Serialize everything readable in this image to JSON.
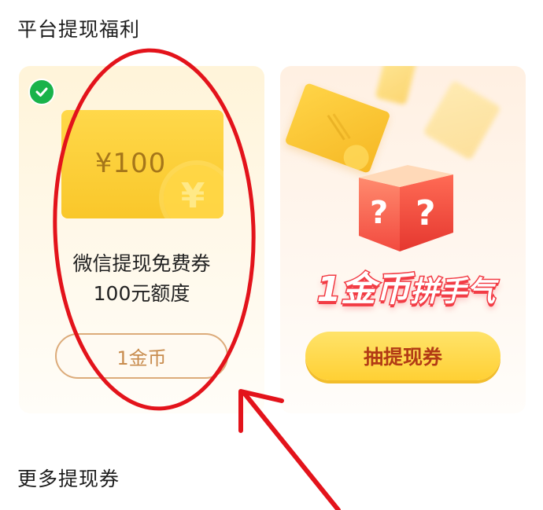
{
  "sections": {
    "top_title": "平台提现福利",
    "bottom_title": "更多提现券"
  },
  "left_card": {
    "badge_icon": "wechat-icon",
    "voucher_amount": "¥100",
    "voucher_coin_symbol": "¥",
    "description_line1": "微信提现免费券",
    "description_line2": "100元额度",
    "button_label": "1金币"
  },
  "right_card": {
    "slogan_highlight": "1金币",
    "slogan_rest": "拼手气",
    "draw_button_label": "抽提现券"
  },
  "colors": {
    "wechat_green": "#19b34a",
    "voucher_gold": "#f9c72a",
    "annotation_red": "#e3131b",
    "draw_button_text": "#b23b15"
  }
}
